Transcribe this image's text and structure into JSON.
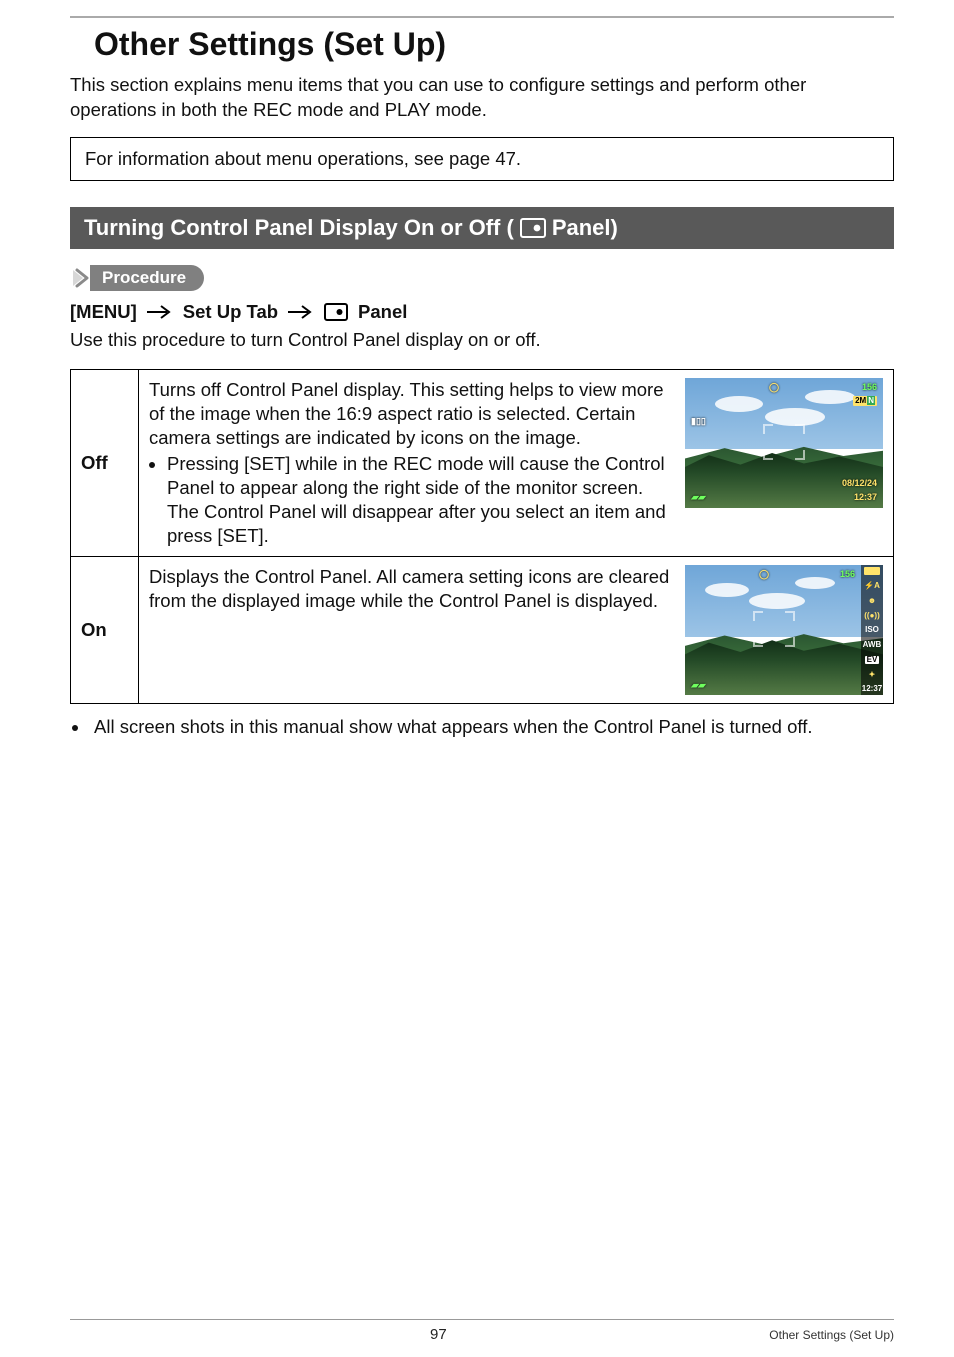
{
  "page": {
    "title": "Other Settings (Set Up)",
    "intro": "This section explains menu items that you can use to configure settings and perform other operations in both the REC mode and PLAY mode.",
    "info_ref": "For information about menu operations, see page 47.",
    "number": "97",
    "footer_section": "Other Settings (Set Up)"
  },
  "section": {
    "heading_prefix": "Turning Control Panel Display On or Off (",
    "heading_suffix": " Panel)"
  },
  "procedure": {
    "label": "Procedure",
    "path": {
      "menu": "[MENU]",
      "tab": "Set Up Tab",
      "item": "Panel"
    },
    "desc": "Use this procedure to turn Control Panel display on or off."
  },
  "options": {
    "off": {
      "label": "Off",
      "text": "Turns off Control Panel display. This setting helps to view more of the image when the 16:9 aspect ratio is selected. Certain camera settings are indicated by icons on the image.",
      "bullet": "Pressing [SET] while in the REC mode will cause the Control Panel to appear along the right side of the monitor screen. The Control Panel will disappear after you select an item and press [SET]."
    },
    "on": {
      "label": "On",
      "text": "Displays the Control Panel. All camera setting icons are cleared from the displayed image while the Control Panel is displayed."
    }
  },
  "preview": {
    "shots": "156",
    "size_tag": "2M",
    "date": "08/12/24",
    "time": "12:37",
    "iso": "ISO",
    "awb": "AWB",
    "ev": "EV",
    "flash": "⚡A"
  },
  "note": "All screen shots in this manual show what appears when the Control Panel is turned off."
}
